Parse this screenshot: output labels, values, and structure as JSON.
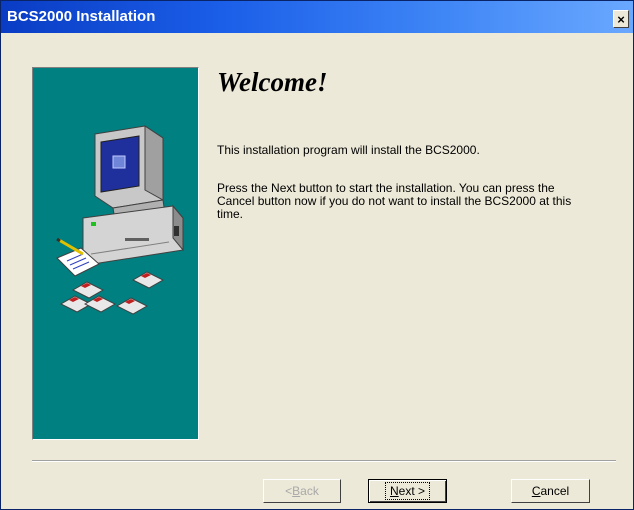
{
  "window": {
    "title": "BCS2000 Installation",
    "close_glyph": "×"
  },
  "content": {
    "heading": "Welcome!",
    "paragraph1": "This installation program will install the BCS2000.",
    "paragraph2": "Press the Next button to start the installation. You can press the Cancel button now if you do not want to install the BCS2000 at this time."
  },
  "buttons": {
    "back": {
      "arrow": "< ",
      "mnemonic": "B",
      "rest": "ack"
    },
    "next": {
      "mnemonic": "N",
      "rest": "ext",
      "arrow": " >"
    },
    "cancel": {
      "mnemonic": "C",
      "rest": "ancel"
    }
  },
  "colors": {
    "title_bar": "#0a3cc4",
    "panel": "#008080",
    "dialog_bg": "#ece9d8"
  }
}
